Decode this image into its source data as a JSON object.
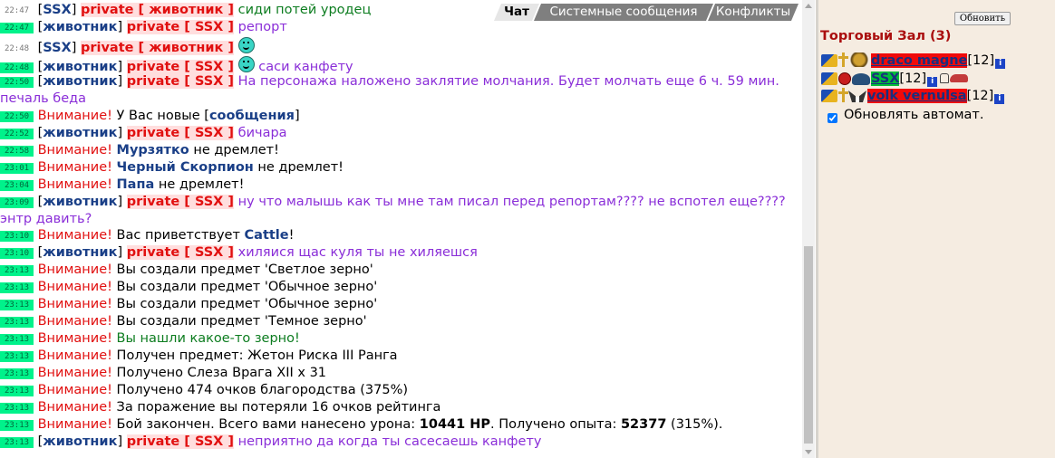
{
  "tabs": [
    {
      "label": "Чат"
    },
    {
      "label": "Системные сообщения"
    },
    {
      "label": "Конфликты"
    }
  ],
  "chat": {
    "lines": [
      {
        "time": "22:47",
        "nick": "SSX",
        "priv": "private [ животник ]",
        "text": "сиди потей уродец"
      },
      {
        "time": "22:47",
        "nick": "животник",
        "priv": "private [ SSX ]",
        "text": "репорт"
      },
      {
        "time": "22:48",
        "nick": "SSX",
        "priv": "private [ животник ]",
        "text": ""
      },
      {
        "time": "22:48",
        "nick": "животник",
        "priv": "private [ SSX ]",
        "text": "саси канфету"
      },
      {
        "time": "22:50",
        "nick": "животник",
        "priv": "private [ SSX ]",
        "text": "На персонажа наложено заклятие молчания. Будет молчать еще 6 ч. 59 мин. печаль беда"
      },
      {
        "time": "22:50",
        "warn": "Внимание!",
        "p1": "У Вас новые [",
        "link": "сообщения",
        "p2": "]"
      },
      {
        "time": "22:52",
        "nick": "животник",
        "priv": "private [ SSX ]",
        "text": "бичара"
      },
      {
        "time": "22:58",
        "warn": "Внимание!",
        "name": "Мурзятко",
        "rest": "не дремлет!"
      },
      {
        "time": "23:01",
        "warn": "Внимание!",
        "name": "Черный Скорпион",
        "rest": "не дремлет!"
      },
      {
        "time": "23:04",
        "warn": "Внимание!",
        "name": "Папа",
        "rest": "не дремлет!"
      },
      {
        "time": "23:09",
        "nick": "животник",
        "priv": "private [ SSX ]",
        "text": "ну что малышь как ты мне там писал перед репортам???? не вспотел еще???? энтр давить?"
      },
      {
        "time": "23:10",
        "warn": "Внимание!",
        "p1": "Вас приветствует",
        "name": "Cattle",
        "p2": "!"
      },
      {
        "time": "23:10",
        "nick": "животник",
        "priv": "private [ SSX ]",
        "text": "хиляися щас куля ты не хиляешся"
      },
      {
        "time": "23:13",
        "warn": "Внимание!",
        "text": "Вы создали предмет 'Светлое зерно'"
      },
      {
        "time": "23:13",
        "warn": "Внимание!",
        "text": "Вы создали предмет 'Обычное зерно'"
      },
      {
        "time": "23:13",
        "warn": "Внимание!",
        "text": "Вы создали предмет 'Обычное зерно'"
      },
      {
        "time": "23:13",
        "warn": "Внимание!",
        "text": "Вы создали предмет 'Темное зерно'"
      },
      {
        "time": "23:13",
        "warn": "Внимание!",
        "text": "Вы нашли какое-то зерно!"
      },
      {
        "time": "23:13",
        "warn": "Внимание!",
        "text": "Получен предмет: Жетон Риска III Ранга"
      },
      {
        "time": "23:13",
        "warn": "Внимание!",
        "text": "Получено Слеза Врага XII x 31"
      },
      {
        "time": "23:13",
        "warn": "Внимание!",
        "text": "Получено 474 очков благородства (375%)"
      },
      {
        "time": "23:13",
        "warn": "Внимание!",
        "text": "За поражение вы потеряли 16 очков рейтинга"
      },
      {
        "time": "23:13",
        "warn": "Внимание!",
        "p1": "Бой закончен. Всего вами нанесено урона:",
        "b1": "10441 HP",
        "p2": ". Получено опыта:",
        "b2": "52377",
        "p3": "(315%)."
      },
      {
        "time": "23:13",
        "nick": "животник",
        "priv": "private [ SSX ]",
        "text": "неприятно да когда ты сасесаешь канфету"
      }
    ]
  },
  "panel": {
    "refresh_label": "Обновить",
    "room_title": "Торговый Зал (3)",
    "players": [
      {
        "name": "draco magne",
        "level": "[12]"
      },
      {
        "name": "SSX",
        "level": "[12]"
      },
      {
        "name": "volk vernulsa",
        "level": "[12]"
      }
    ],
    "auto_label": "Обновлять автомат.",
    "auto_checked": true
  }
}
